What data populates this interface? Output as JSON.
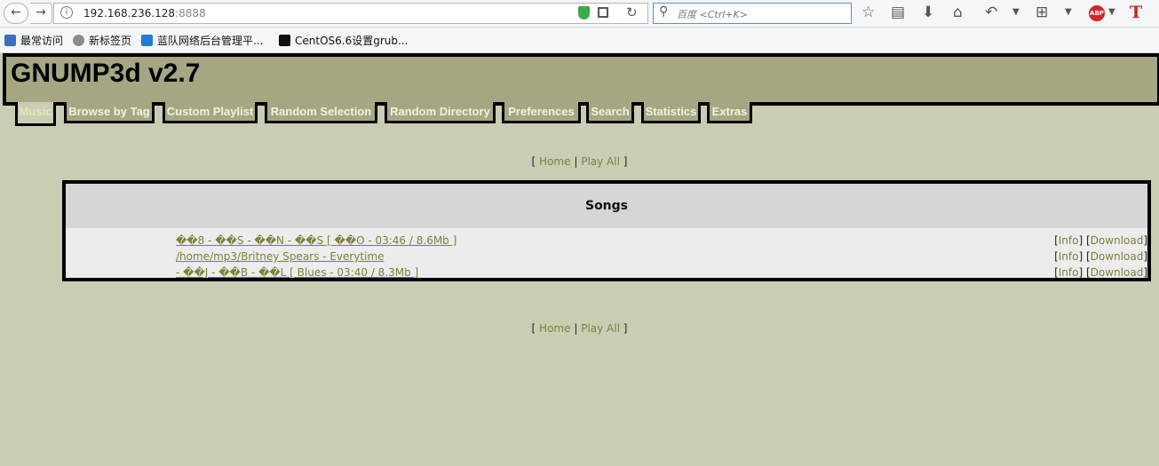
{
  "browser": {
    "url_host": "192.168.236.128",
    "url_port": ":8888",
    "search_placeholder": "百度 <Ctrl+K>",
    "icons": [
      "back-icon",
      "forward-icon",
      "info-icon",
      "shield-icon",
      "qr-icon",
      "reload-icon",
      "search-icon",
      "star-icon",
      "reader-icon",
      "download-icon",
      "home-icon",
      "undo-icon",
      "crop-icon",
      "adblock-icon",
      "translate-icon"
    ],
    "abp_label": "ABP",
    "t_label": "T",
    "bookmarks": [
      {
        "label": "最常访问"
      },
      {
        "label": "新标签页"
      },
      {
        "label": "蓝队网络后台管理平..."
      },
      {
        "label": "CentOS6.6设置grub..."
      }
    ]
  },
  "page": {
    "title": "GNUMP3d v2.7",
    "tabs": [
      {
        "label": "Music"
      },
      {
        "label": "Browse by Tag"
      },
      {
        "label": "Custom Playlist"
      },
      {
        "label": "Random Selection"
      },
      {
        "label": "Random Directory"
      },
      {
        "label": "Preferences"
      },
      {
        "label": "Search"
      },
      {
        "label": "Statistics"
      },
      {
        "label": "Extras"
      }
    ],
    "nav": {
      "open": "[",
      "home": "Home",
      "sep": "|",
      "play_all": "Play All",
      "close": "]"
    },
    "songs_heading": "Songs",
    "songs": [
      {
        "title": "��8 - ��S - ��N - ��S [ ��O - 03:46 / 8.6Mb ]"
      },
      {
        "title": "/home/mp3/Britney Spears - Everytime"
      },
      {
        "title": "- ��J - ��B - ��L [ Blues - 03:40 / 8.3Mb ]"
      }
    ],
    "song_actions": {
      "info": "Info",
      "download": "Download"
    }
  },
  "colors": {
    "page_bg": "#cacdb4",
    "header_bg": "#a6a782",
    "link": "#7f7f3a",
    "table_head_bg": "#d4d6d8"
  }
}
